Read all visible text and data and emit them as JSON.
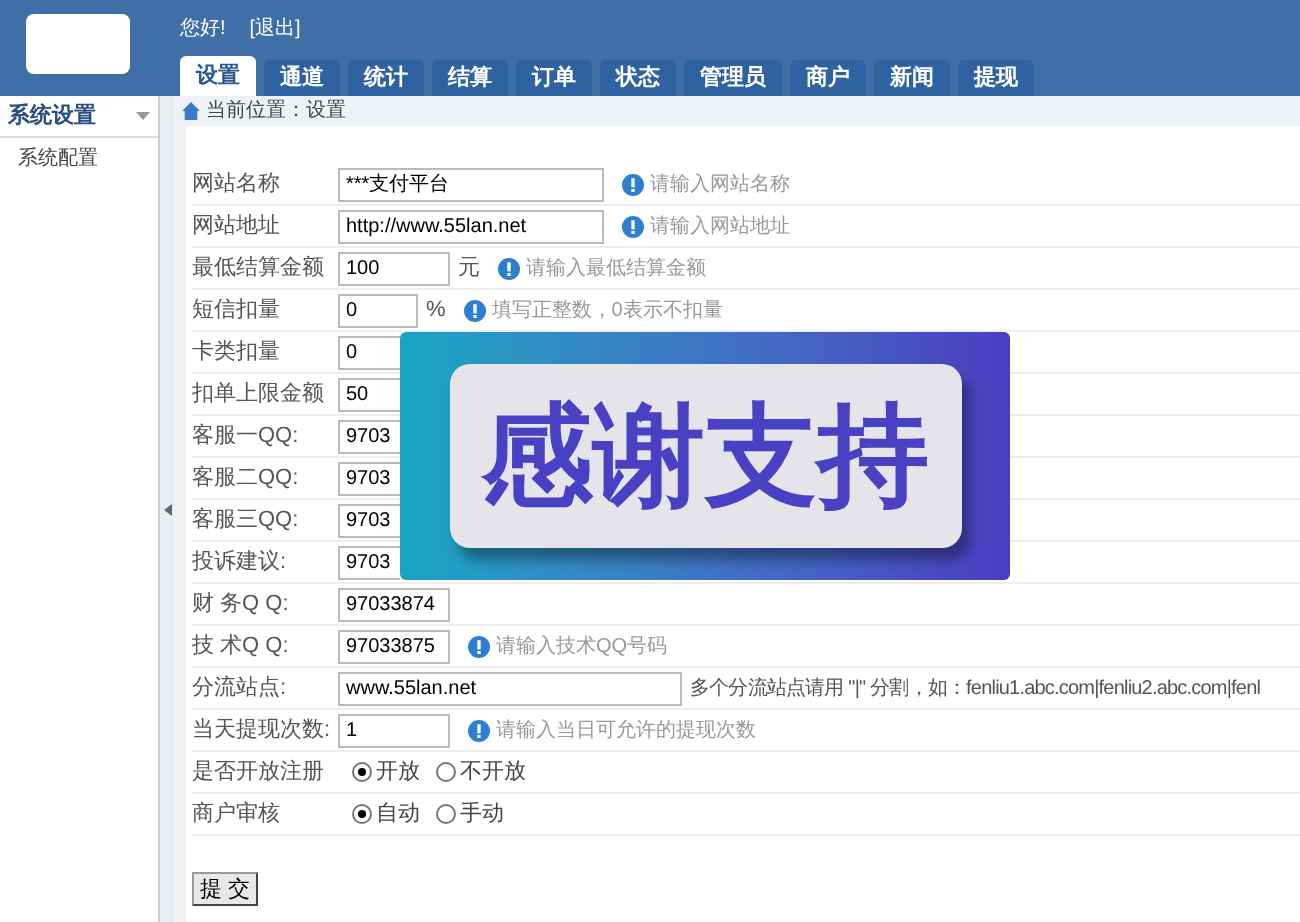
{
  "header": {
    "greeting": "您好!",
    "logout": "[退出]"
  },
  "tabs": [
    {
      "label": "设置",
      "selected": true
    },
    {
      "label": "通道",
      "selected": false
    },
    {
      "label": "统计",
      "selected": false
    },
    {
      "label": "结算",
      "selected": false
    },
    {
      "label": "订单",
      "selected": false
    },
    {
      "label": "状态",
      "selected": false
    },
    {
      "label": "管理员",
      "selected": false
    },
    {
      "label": "商户",
      "selected": false
    },
    {
      "label": "新闻",
      "selected": false
    },
    {
      "label": "提现",
      "selected": false
    }
  ],
  "sidebar": {
    "title": "系统设置",
    "items": [
      {
        "label": "系统配置"
      }
    ]
  },
  "breadcrumb": "当前位置：设置",
  "fields": [
    {
      "kind": "long",
      "label": "网站名称",
      "value": "***支付平台",
      "hint": "请输入网站名称"
    },
    {
      "kind": "long",
      "label": "网站地址",
      "value": "http://www.55lan.net",
      "hint": "请输入网站地址"
    },
    {
      "kind": "short",
      "label": "最低结算金额",
      "value": "100",
      "suffix": "元",
      "hint": "请输入最低结算金额"
    },
    {
      "kind": "tiny",
      "label": "短信扣量",
      "value": "0",
      "suffix": "%",
      "hint": "填写正整数，0表示不扣量"
    },
    {
      "kind": "covered",
      "label": "卡类扣量",
      "value": "0"
    },
    {
      "kind": "covered",
      "label": "扣单上限金额",
      "value": "50"
    },
    {
      "kind": "covered",
      "label": "客服一QQ:",
      "value": "9703"
    },
    {
      "kind": "covered",
      "label": "客服二QQ:",
      "value": "9703"
    },
    {
      "kind": "covered",
      "label": "客服三QQ:",
      "value": "9703"
    },
    {
      "kind": "covered",
      "label": "投诉建议:",
      "value": "9703"
    },
    {
      "kind": "short",
      "label": "财 务Q Q:",
      "value": "97033874"
    },
    {
      "kind": "short",
      "label": "技 术Q Q:",
      "value": "97033875",
      "hint": "请输入技术QQ号码"
    },
    {
      "kind": "wide",
      "label": "分流站点:",
      "value": "www.55lan.net",
      "note": "多个分流站点请用 \"|\" 分割，如：fenliu1.abc.com|fenliu2.abc.com|fenl"
    },
    {
      "kind": "short",
      "label": "当天提现次数:",
      "value": "1",
      "hint": "请输入当日可允许的提现次数"
    },
    {
      "kind": "radio",
      "label": "是否开放注册",
      "options": [
        {
          "label": "开放",
          "selected": true
        },
        {
          "label": "不开放",
          "selected": false
        }
      ]
    },
    {
      "kind": "radio",
      "label": "商户审核",
      "options": [
        {
          "label": "自动",
          "selected": true
        },
        {
          "label": "手动",
          "selected": false
        }
      ]
    }
  ],
  "submit": "提 交",
  "overlay_banner": {
    "text": "感谢支持"
  }
}
